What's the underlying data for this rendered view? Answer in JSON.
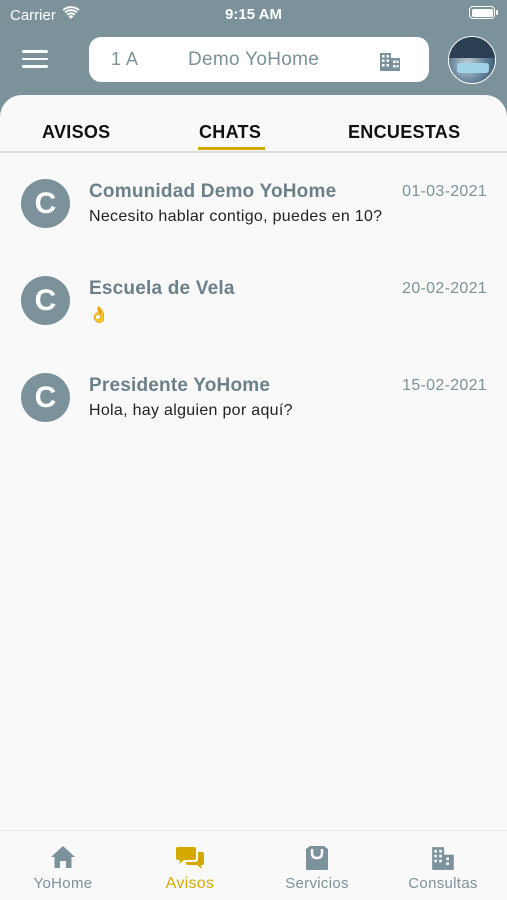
{
  "status_bar": {
    "carrier": "Carrier",
    "time": "9:15 AM",
    "icons": [
      "wifi-icon",
      "battery-icon"
    ]
  },
  "header": {
    "menu_icon": "hamburger-menu-icon",
    "unit": "1 A",
    "community": "Demo YoHome",
    "building_icon": "building-icon"
  },
  "tabs": [
    {
      "label": "AVISOS",
      "active": false
    },
    {
      "label": "CHATS",
      "active": true
    },
    {
      "label": "ENCUESTAS",
      "active": false
    }
  ],
  "chats": [
    {
      "initial": "C",
      "name": "Comunidad Demo YoHome",
      "date": "01-03-2021",
      "message": "Necesito hablar contigo, puedes en 10?"
    },
    {
      "initial": "C",
      "name": "Escuela de Vela",
      "date": "20-02-2021",
      "message": "👌"
    },
    {
      "initial": "C",
      "name": "Presidente YoHome",
      "date": "15-02-2021",
      "message": "Hola, hay alguien por aquí?"
    }
  ],
  "bottom_nav": [
    {
      "label": "YoHome",
      "icon": "home-icon",
      "active": false
    },
    {
      "label": "Avisos",
      "icon": "chat-bubbles-icon",
      "active": true
    },
    {
      "label": "Servicios",
      "icon": "shopping-bag-icon",
      "active": false
    },
    {
      "label": "Consultas",
      "icon": "building-icon",
      "active": false
    }
  ],
  "colors": {
    "header_bg": "#7b929a",
    "accent": "#d4a900",
    "content_bg": "#f9f9f9"
  }
}
